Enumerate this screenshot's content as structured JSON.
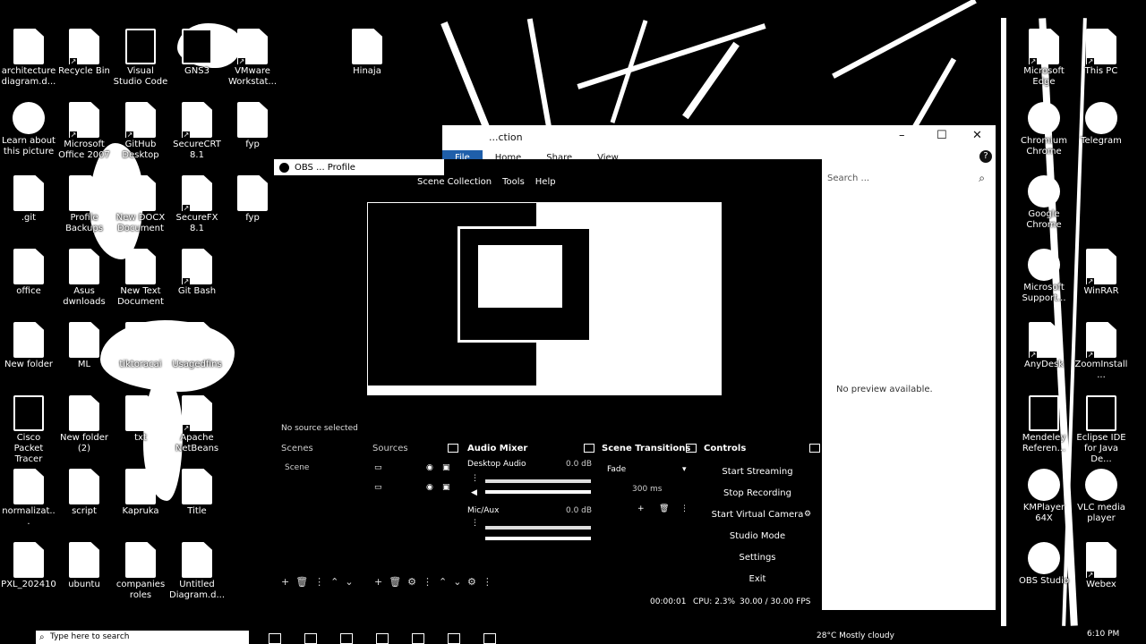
{
  "desktop": {
    "icons": [
      {
        "label": "architecture diagram.d...",
        "icon": "document-icon"
      },
      {
        "label": "Recycle Bin",
        "icon": "recycle-bin-icon"
      },
      {
        "label": "Visual Studio Code",
        "icon": "vscode-icon"
      },
      {
        "label": "GNS3",
        "icon": "gns3-icon"
      },
      {
        "label": "VMware Workstat...",
        "icon": "vmware-icon"
      },
      {
        "label": "Hinaja",
        "icon": "document-icon"
      },
      {
        "label": "Learn about this picture",
        "icon": "camera-icon"
      },
      {
        "label": "Microsoft Office 2007",
        "icon": "office-icon"
      },
      {
        "label": "GitHub Desktop",
        "icon": "github-icon"
      },
      {
        "label": "SecureCRT 8.1",
        "icon": "securecrt-icon"
      },
      {
        "label": "fyp",
        "icon": "pdf-icon"
      },
      {
        "label": ".git",
        "icon": "folder-icon"
      },
      {
        "label": "Profile Backups",
        "icon": "folder-icon"
      },
      {
        "label": "New DOCX Document",
        "icon": "word-icon"
      },
      {
        "label": "SecureFX 8.1",
        "icon": "securefx-icon"
      },
      {
        "label": "fyp",
        "icon": "word-icon"
      },
      {
        "label": "office",
        "icon": "folder-icon"
      },
      {
        "label": "Asus dwnloads",
        "icon": "folder-icon"
      },
      {
        "label": "New Text Document",
        "icon": "text-file-icon"
      },
      {
        "label": "Git Bash",
        "icon": "git-bash-icon"
      },
      {
        "label": "New folder",
        "icon": "folder-icon"
      },
      {
        "label": "ML",
        "icon": "folder-icon"
      },
      {
        "label": "tiktoracai",
        "icon": "text-file-icon"
      },
      {
        "label": "Usagedfins",
        "icon": "word-icon"
      },
      {
        "label": "Cisco Packet Tracer",
        "icon": "packet-tracer-icon"
      },
      {
        "label": "New folder (2)",
        "icon": "folder-icon"
      },
      {
        "label": "txt",
        "icon": "text-file-icon"
      },
      {
        "label": "Apache NetBeans",
        "icon": "netbeans-icon"
      },
      {
        "label": "normalizat...",
        "icon": "document-icon"
      },
      {
        "label": "script",
        "icon": "text-file-icon"
      },
      {
        "label": "Kapruka",
        "icon": "text-file-icon"
      },
      {
        "label": "Title",
        "icon": "word-icon"
      },
      {
        "label": "PXL_202410",
        "icon": "image-icon"
      },
      {
        "label": "ubuntu",
        "icon": "text-file-icon"
      },
      {
        "label": "companies roles",
        "icon": "text-file-icon"
      },
      {
        "label": "Untitled Diagram.d...",
        "icon": "document-icon"
      },
      {
        "label": "Microsoft Edge",
        "icon": "edge-icon"
      },
      {
        "label": "This PC",
        "icon": "pc-icon"
      },
      {
        "label": "Chromium Chrome",
        "icon": "chrome-icon"
      },
      {
        "label": "Telegram",
        "icon": "telegram-icon"
      },
      {
        "label": "Google Chrome",
        "icon": "chrome-icon"
      },
      {
        "label": "Microsoft Support...",
        "icon": "help-icon"
      },
      {
        "label": "WinRAR",
        "icon": "winrar-icon"
      },
      {
        "label": "AnyDesk",
        "icon": "anydesk-icon"
      },
      {
        "label": "ZoomInstall...",
        "icon": "zoom-icon"
      },
      {
        "label": "Mendeley Referen...",
        "icon": "mendeley-icon"
      },
      {
        "label": "Eclipse IDE for Java De...",
        "icon": "eclipse-icon"
      },
      {
        "label": "KMPlayer 64X",
        "icon": "kmplayer-icon"
      },
      {
        "label": "VLC media player",
        "icon": "vlc-icon"
      },
      {
        "label": "OBS Studio",
        "icon": "obs-icon"
      },
      {
        "label": "Webex",
        "icon": "webex-icon"
      }
    ]
  },
  "explorer": {
    "title": "...ction",
    "ribbon_tabs": [
      "File",
      "Home",
      "Share",
      "View"
    ],
    "search_placeholder": "Search ...",
    "no_preview": "No preview available.",
    "min_glyph": "–",
    "max_glyph": "☐",
    "close_glyph": "✕",
    "help_glyph": "?"
  },
  "obs": {
    "title": "OBS ... Profile",
    "menu": [
      "Scene Collection",
      "Tools",
      "Help"
    ],
    "status": "No source selected",
    "docks": {
      "scenes": "Scenes",
      "sources": "Sources",
      "audio_mixer": "Audio Mixer",
      "scene_transitions": "Scene Transitions",
      "controls": "Controls"
    },
    "scene_item": "Scene",
    "audio": {
      "desktop": "Desktop Audio",
      "desktop_db": "0.0 dB",
      "mic": "Mic/Aux",
      "mic_db": "0.0 dB"
    },
    "transitions": {
      "type": "Fade",
      "duration": "300 ms"
    },
    "controls": [
      "Start Streaming",
      "Stop Recording",
      "Start Virtual Camera",
      "Studio Mode",
      "Settings",
      "Exit"
    ],
    "footer": {
      "time": "00:00:01",
      "cpu": "CPU: 2.3%",
      "fps": "30.00 / 30.00 FPS"
    }
  },
  "taskbar": {
    "search_placeholder": "Type here to search",
    "weather": "28°C Mostly cloudy",
    "clock": "6:10 PM"
  },
  "colors": {
    "explorer_file_tab": "#1f5faa",
    "background": "#000000",
    "foreground": "#ffffff"
  }
}
